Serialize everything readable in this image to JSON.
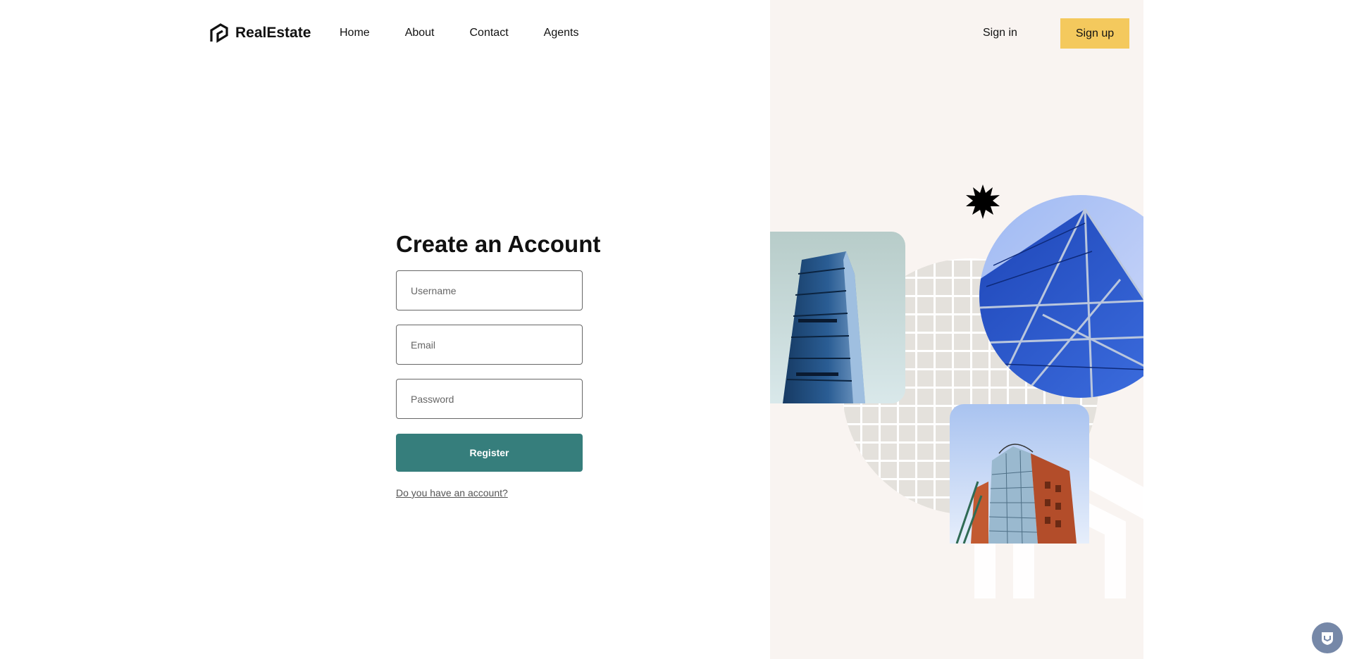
{
  "header": {
    "brand": "RealEstate",
    "nav": [
      "Home",
      "About",
      "Contact",
      "Agents"
    ],
    "sign_in": "Sign in",
    "sign_up": "Sign up"
  },
  "form": {
    "title": "Create an Account",
    "username_placeholder": "Username",
    "email_placeholder": "Email",
    "password_placeholder": "Password",
    "submit_label": "Register",
    "account_link": "Do you have an account?"
  },
  "icons": {
    "logo": "house-logo-icon",
    "decoration": "starburst-icon",
    "help": "shield-chat-icon"
  },
  "colors": {
    "accent": "#367e7c",
    "signup_bg": "#f4c95d",
    "panel_bg": "#f9f4f1",
    "help_button": "#7688a8"
  }
}
